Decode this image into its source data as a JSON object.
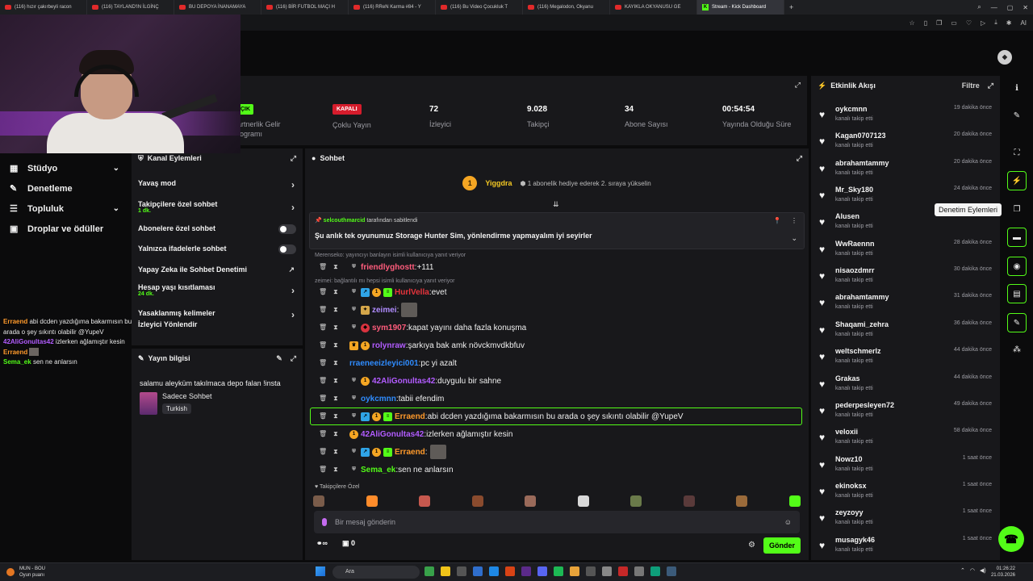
{
  "browser": {
    "tabs": [
      {
        "label": "(116) hızır çakırbeyli racon"
      },
      {
        "label": "(116) TAYLAND'IN İLGİNÇ"
      },
      {
        "label": "BU DEPOYA İNANAMAYA"
      },
      {
        "label": "(116) BİR FUTBOL MAÇI H"
      },
      {
        "label": "(116) RReN Karma #84 - Y"
      },
      {
        "label": "(116) Bu Video Çocukluk T"
      },
      {
        "label": "(116) Megalodon, Okyanu"
      },
      {
        "label": "KAYIKLA OKYANUSU GE"
      },
      {
        "label": "Stream - Kick Dashboard"
      }
    ],
    "ai_label": "AI"
  },
  "leftnav": {
    "items": [
      {
        "label": "Stüdyo",
        "icon": "grid-icon"
      },
      {
        "label": "Denetleme",
        "icon": "wrench-icon"
      },
      {
        "label": "Topluluk",
        "icon": "users-icon"
      },
      {
        "label": "Droplar ve ödüller",
        "icon": "gift-icon"
      }
    ]
  },
  "overlay_chat": [
    {
      "user": "Erraend",
      "text": "abi dcden yazdığıma bakarmısın bu arada o şey sıkıntı olabilir @YupeV"
    },
    {
      "user": "42AliGonultas42",
      "text": "izlerken ağlamıştır kesin"
    },
    {
      "user": "Erraend",
      "text": ""
    },
    {
      "user": "Sema_ek",
      "text": "sen ne anlarsın"
    }
  ],
  "stats": {
    "partner_badge": "ÇIK",
    "partner_label": "artnerlik Gelir\nrogramı",
    "multistream_badge": "KAPALI",
    "multistream_label": "Çoklu Yayın",
    "viewers": "72",
    "viewers_label": "İzleyici",
    "followers": "9.028",
    "followers_label": "Takipçi",
    "subs": "34",
    "subs_label": "Abone Sayısı",
    "uptime": "00:54:54",
    "uptime_label": "Yayında Olduğu Süre"
  },
  "channel_actions": {
    "title": "Kanal Eylemleri",
    "items": [
      {
        "label": "Yavaş mod",
        "sub": ""
      },
      {
        "label": "Takipçilere özel sohbet",
        "sub": "1 dk."
      },
      {
        "label": "Abonelere özel sohbet",
        "sub": ""
      },
      {
        "label": "Yalnızca ifadelerle sohbet",
        "sub": ""
      },
      {
        "label": "Yapay Zeka ile Sohbet Denetimi",
        "sub": ""
      },
      {
        "label": "Hesap yaşı kısıtlaması",
        "sub": "24 dk."
      },
      {
        "label": "Yasaklanmış kelimeler",
        "sub": ""
      },
      {
        "label": "İzleyici Yönlendir",
        "sub": ""
      }
    ]
  },
  "stream_info": {
    "title": "Yayın bilgisi",
    "stream_title": "salamu aleyküm takılmaca depo falan !insta",
    "category": "Sadece Sohbet",
    "language": "Turkish"
  },
  "chat": {
    "title": "Sohbet",
    "top_user": "Yiggdra",
    "top_user_badge": "1",
    "gift_notice": "1 abonelik hediye ederek 2. sıraya yükselin",
    "pinned_by": "selcouthmarcid",
    "pinned_suffix": "tarafından sabitlendi",
    "pinned_text": "Şu anlık tek oyunumuz Storage Hunter Sim, yönlendirme yapmayalım iyi seyirler",
    "replies": [
      {
        "text": "Merenseko: yayıncıyı banlayın isimli kullanıcıya yanıt veriyor"
      },
      {
        "text": "zeimei: bağlantılı mı hepsi isimli kullanıcıya yanıt veriyor"
      }
    ],
    "messages": [
      {
        "user": "friendlyghostt",
        "text": "+111",
        "color": "#ff5c7c"
      },
      {
        "user": "HurlVella",
        "text": "evet",
        "color": "#e8343c"
      },
      {
        "user": "zeimei",
        "text": "",
        "color": "#b08cff"
      },
      {
        "user": "sym1907",
        "text": "kapat yayını daha fazla konuşma",
        "color": "#ff5c7c"
      },
      {
        "user": "rolynraw",
        "text": "şarkıya bak amk növckmvdkbfuv",
        "color": "#b25cff"
      },
      {
        "user": "rraeneeizleyici001",
        "text": "pc yi azalt",
        "color": "#2f8cff"
      },
      {
        "user": "42AliGonultas42",
        "text": "duygulu bir sahne",
        "color": "#b25cff"
      },
      {
        "user": "oykcmnn",
        "text": "tabii efendim",
        "color": "#2f8cff"
      },
      {
        "user": "Erraend",
        "text": "abi dcden yazdığıma bakarmısın bu arada o şey sıkıntı olabilir @YupeV",
        "color": "#ff9a2b"
      },
      {
        "user": "42AliGonultas42",
        "text": "izlerken ağlamıştır kesin",
        "color": "#b25cff"
      },
      {
        "user": "Erraend",
        "text": "",
        "color": "#ff9a2b"
      },
      {
        "user": "Sema_ek",
        "text": "sen ne anlarsın",
        "color": "#53fc18"
      }
    ],
    "followers_only_label": "Takipçilere Özel",
    "input_placeholder": "Bir mesaj gönderin",
    "viewers_count": "0",
    "send_label": "Gönder"
  },
  "activity": {
    "title": "Etkinlik Akışı",
    "filter_label": "Filtre",
    "tooltip": "Denetim Eylemleri",
    "items": [
      {
        "name": "oykcmnn",
        "action": "kanalı takip etti",
        "time": "19 dakika önce"
      },
      {
        "name": "Kagan0707123",
        "action": "kanalı takip etti",
        "time": "20 dakika önce"
      },
      {
        "name": "abrahamtammy",
        "action": "kanalı takip etti",
        "time": "20 dakika önce"
      },
      {
        "name": "Mr_Sky180",
        "action": "kanalı takip etti",
        "time": "24 dakika önce"
      },
      {
        "name": "Alusen",
        "action": "kanalı takip etti",
        "time": ""
      },
      {
        "name": "WwRaennn",
        "action": "kanalı takip etti",
        "time": "28 dakika önce"
      },
      {
        "name": "nisaozdmrr",
        "action": "kanalı takip etti",
        "time": "30 dakika önce"
      },
      {
        "name": "abrahamtammy",
        "action": "kanalı takip etti",
        "time": "31 dakika önce"
      },
      {
        "name": "Shaqami_zehra",
        "action": "kanalı takip etti",
        "time": "36 dakika önce"
      },
      {
        "name": "weltschmerlz",
        "action": "kanalı takip etti",
        "time": "44 dakika önce"
      },
      {
        "name": "Grakas",
        "action": "kanalı takip etti",
        "time": "44 dakika önce"
      },
      {
        "name": "pederpesleyen72",
        "action": "kanalı takip etti",
        "time": "49 dakika önce"
      },
      {
        "name": "veloxii",
        "action": "kanalı takip etti",
        "time": "58 dakika önce"
      },
      {
        "name": "Nowz10",
        "action": "kanalı takip etti",
        "time": "1 saat önce"
      },
      {
        "name": "ekinoksx",
        "action": "kanalı takip etti",
        "time": "1 saat önce"
      },
      {
        "name": "zeyzoyy",
        "action": "kanalı takip etti",
        "time": "1 saat önce"
      },
      {
        "name": "musagyk46",
        "action": "kanalı takip etti",
        "time": "1 saat önce"
      }
    ]
  },
  "taskbar": {
    "weather_line1": "MUN - BOU",
    "weather_line2": "Oyun puanı",
    "search_placeholder": "Ara",
    "time": "01:26:22",
    "date": "21.03.2026"
  }
}
